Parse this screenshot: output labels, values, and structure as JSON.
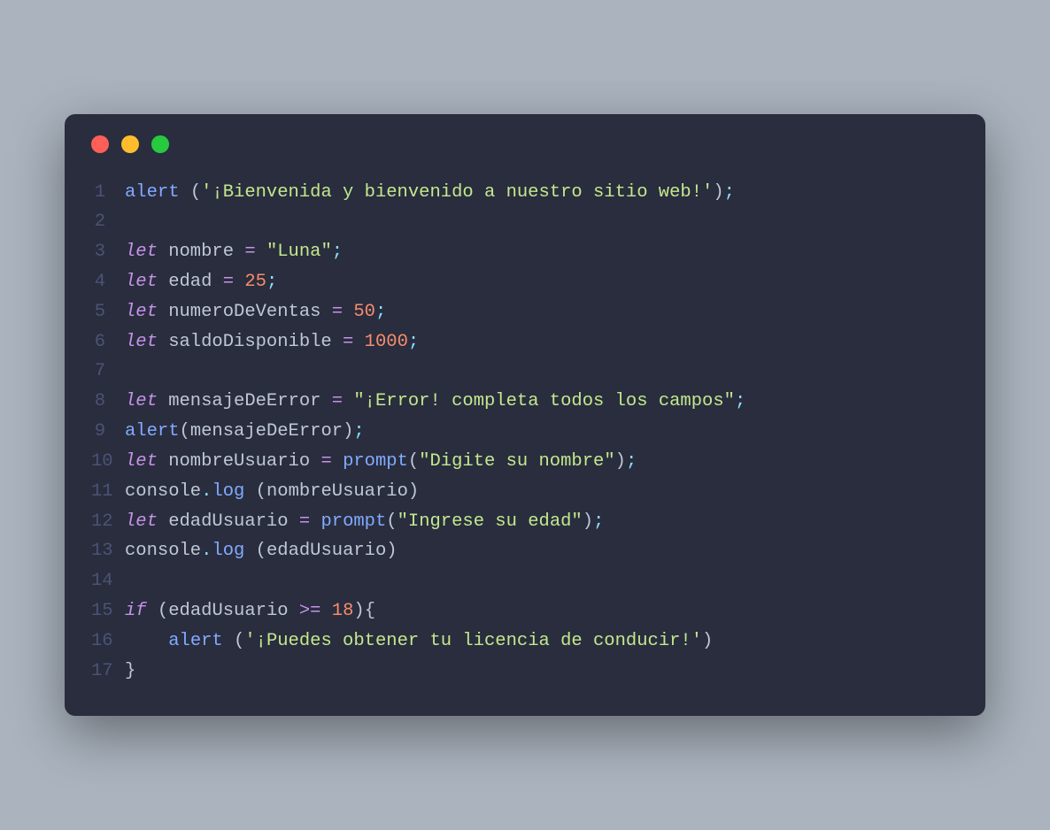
{
  "window": {
    "traffic_lights": {
      "red": "#ff5f56",
      "yellow": "#ffbd2e",
      "green": "#27c93f"
    }
  },
  "code": {
    "lines": [
      {
        "n": "1",
        "tokens": [
          {
            "t": "alert ",
            "c": "fn"
          },
          {
            "t": "(",
            "c": "paren"
          },
          {
            "t": "'¡Bienvenida y bienvenido a nuestro sitio web!'",
            "c": "str"
          },
          {
            "t": ")",
            "c": "paren"
          },
          {
            "t": ";",
            "c": "punc"
          }
        ]
      },
      {
        "n": "2",
        "tokens": []
      },
      {
        "n": "3",
        "tokens": [
          {
            "t": "let",
            "c": "kw"
          },
          {
            "t": " nombre ",
            "c": "var"
          },
          {
            "t": "=",
            "c": "op"
          },
          {
            "t": " ",
            "c": "var"
          },
          {
            "t": "\"Luna\"",
            "c": "str"
          },
          {
            "t": ";",
            "c": "punc"
          }
        ]
      },
      {
        "n": "4",
        "tokens": [
          {
            "t": "let",
            "c": "kw"
          },
          {
            "t": " edad ",
            "c": "var"
          },
          {
            "t": "=",
            "c": "op"
          },
          {
            "t": " ",
            "c": "var"
          },
          {
            "t": "25",
            "c": "num"
          },
          {
            "t": ";",
            "c": "punc"
          }
        ]
      },
      {
        "n": "5",
        "tokens": [
          {
            "t": "let",
            "c": "kw"
          },
          {
            "t": " numeroDeVentas ",
            "c": "var"
          },
          {
            "t": "=",
            "c": "op"
          },
          {
            "t": " ",
            "c": "var"
          },
          {
            "t": "50",
            "c": "num"
          },
          {
            "t": ";",
            "c": "punc"
          }
        ]
      },
      {
        "n": "6",
        "tokens": [
          {
            "t": "let",
            "c": "kw"
          },
          {
            "t": " saldoDisponible ",
            "c": "var"
          },
          {
            "t": "=",
            "c": "op"
          },
          {
            "t": " ",
            "c": "var"
          },
          {
            "t": "1000",
            "c": "num"
          },
          {
            "t": ";",
            "c": "punc"
          }
        ]
      },
      {
        "n": "7",
        "tokens": []
      },
      {
        "n": "8",
        "tokens": [
          {
            "t": "let",
            "c": "kw"
          },
          {
            "t": " mensajeDeError ",
            "c": "var"
          },
          {
            "t": "=",
            "c": "op"
          },
          {
            "t": " ",
            "c": "var"
          },
          {
            "t": "\"¡Error! completa todos los campos\"",
            "c": "str"
          },
          {
            "t": ";",
            "c": "punc"
          }
        ]
      },
      {
        "n": "9",
        "tokens": [
          {
            "t": "alert",
            "c": "fn"
          },
          {
            "t": "(",
            "c": "paren"
          },
          {
            "t": "mensajeDeError",
            "c": "var"
          },
          {
            "t": ")",
            "c": "paren"
          },
          {
            "t": ";",
            "c": "punc"
          }
        ]
      },
      {
        "n": "10",
        "tokens": [
          {
            "t": "let",
            "c": "kw"
          },
          {
            "t": " nombreUsuario ",
            "c": "var"
          },
          {
            "t": "=",
            "c": "op"
          },
          {
            "t": " ",
            "c": "var"
          },
          {
            "t": "prompt",
            "c": "fn"
          },
          {
            "t": "(",
            "c": "paren"
          },
          {
            "t": "\"Digite su nombre\"",
            "c": "str"
          },
          {
            "t": ")",
            "c": "paren"
          },
          {
            "t": ";",
            "c": "punc"
          }
        ]
      },
      {
        "n": "11",
        "tokens": [
          {
            "t": "console",
            "c": "obj"
          },
          {
            "t": ".",
            "c": "punc"
          },
          {
            "t": "log ",
            "c": "fn"
          },
          {
            "t": "(",
            "c": "paren"
          },
          {
            "t": "nombreUsuario",
            "c": "var"
          },
          {
            "t": ")",
            "c": "paren"
          }
        ]
      },
      {
        "n": "12",
        "tokens": [
          {
            "t": "let",
            "c": "kw"
          },
          {
            "t": " edadUsuario ",
            "c": "var"
          },
          {
            "t": "=",
            "c": "op"
          },
          {
            "t": " ",
            "c": "var"
          },
          {
            "t": "prompt",
            "c": "fn"
          },
          {
            "t": "(",
            "c": "paren"
          },
          {
            "t": "\"Ingrese su edad\"",
            "c": "str"
          },
          {
            "t": ")",
            "c": "paren"
          },
          {
            "t": ";",
            "c": "punc"
          }
        ]
      },
      {
        "n": "13",
        "tokens": [
          {
            "t": "console",
            "c": "obj"
          },
          {
            "t": ".",
            "c": "punc"
          },
          {
            "t": "log ",
            "c": "fn"
          },
          {
            "t": "(",
            "c": "paren"
          },
          {
            "t": "edadUsuario",
            "c": "var"
          },
          {
            "t": ")",
            "c": "paren"
          }
        ]
      },
      {
        "n": "14",
        "tokens": []
      },
      {
        "n": "15",
        "tokens": [
          {
            "t": "if",
            "c": "kw"
          },
          {
            "t": " ",
            "c": "var"
          },
          {
            "t": "(",
            "c": "paren"
          },
          {
            "t": "edadUsuario ",
            "c": "var"
          },
          {
            "t": ">=",
            "c": "op"
          },
          {
            "t": " ",
            "c": "var"
          },
          {
            "t": "18",
            "c": "num"
          },
          {
            "t": ")",
            "c": "paren"
          },
          {
            "t": "{",
            "c": "brace"
          }
        ]
      },
      {
        "n": "16",
        "tokens": [
          {
            "t": "    ",
            "c": "var"
          },
          {
            "t": "alert ",
            "c": "fn"
          },
          {
            "t": "(",
            "c": "paren"
          },
          {
            "t": "'¡Puedes obtener tu licencia de conducir!'",
            "c": "str"
          },
          {
            "t": ")",
            "c": "paren"
          }
        ]
      },
      {
        "n": "17",
        "tokens": [
          {
            "t": "}",
            "c": "brace"
          }
        ]
      }
    ]
  }
}
